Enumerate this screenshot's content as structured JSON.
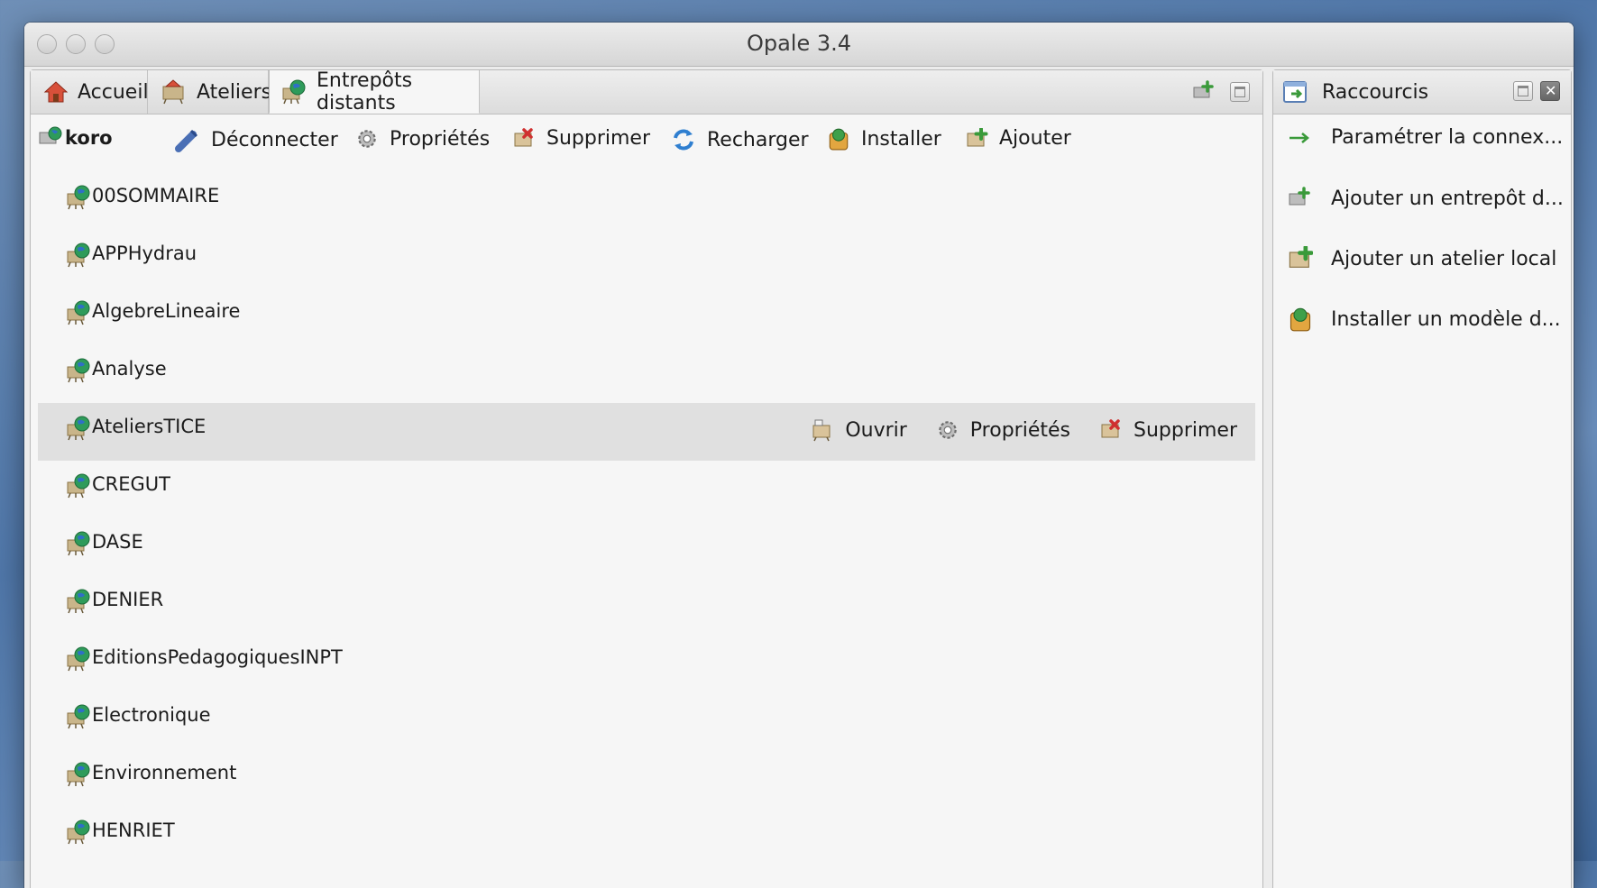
{
  "window": {
    "title": "Opale 3.4"
  },
  "tabs": [
    {
      "label": "Accueil",
      "icon": "home-icon"
    },
    {
      "label": "Ateliers",
      "icon": "workshop-icon"
    },
    {
      "label": "Entrepôts distants",
      "icon": "remote-repository-icon",
      "active": true
    }
  ],
  "repository": {
    "name": "koro",
    "actions": [
      {
        "label": "Déconnecter",
        "icon": "disconnect-plug-icon"
      },
      {
        "label": "Propriétés",
        "icon": "properties-gear-icon"
      },
      {
        "label": "Supprimer",
        "icon": "delete-icon"
      },
      {
        "label": "Recharger",
        "icon": "reload-icon"
      },
      {
        "label": "Installer",
        "icon": "install-package-icon"
      },
      {
        "label": "Ajouter",
        "icon": "add-icon"
      }
    ]
  },
  "workshops": [
    "00SOMMAIRE",
    "APPHydrau",
    "AlgebreLineaire",
    "Analyse",
    "AteliersTICE",
    "CREGUT",
    "DASE",
    "DENIER",
    "EditionsPedagogiquesINPT",
    "Electronique",
    "Environnement",
    "HENRIET"
  ],
  "selected_workshop": {
    "name": "AteliersTICE",
    "actions": [
      {
        "label": "Ouvrir",
        "icon": "open-icon"
      },
      {
        "label": "Propriétés",
        "icon": "properties-gear-icon"
      },
      {
        "label": "Supprimer",
        "icon": "delete-icon"
      }
    ]
  },
  "shortcuts_panel": {
    "title": "Raccourcis",
    "items": [
      {
        "label": "Paramétrer la connex...",
        "icon": "arrow-right-icon"
      },
      {
        "label": "Ajouter un entrepôt d...",
        "icon": "add-repository-icon"
      },
      {
        "label": "Ajouter un atelier local",
        "icon": "add-workshop-icon"
      },
      {
        "label": "Installer un modèle d...",
        "icon": "install-package-icon"
      }
    ]
  },
  "colors": {
    "accent_green": "#3a9a3a",
    "delete_red": "#d03030",
    "selection": "#e0e0e0"
  }
}
